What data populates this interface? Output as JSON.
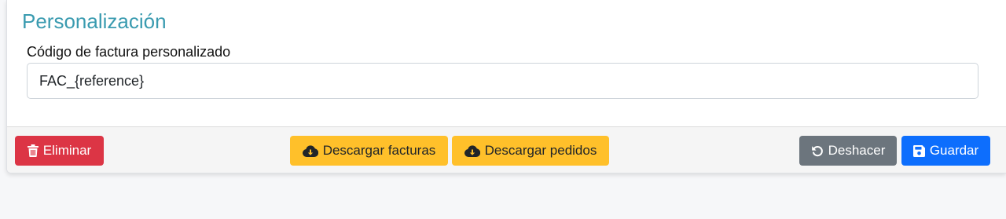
{
  "section": {
    "title": "Personalización"
  },
  "field": {
    "label": "Código de factura personalizado",
    "value": "FAC_{reference}"
  },
  "footer": {
    "delete_label": "Eliminar",
    "download_invoices_label": "Descargar facturas",
    "download_orders_label": "Descargar pedidos",
    "undo_label": "Deshacer",
    "save_label": "Guardar"
  },
  "icons": {
    "delete": "trash-icon",
    "download_invoices": "cloud-download-icon",
    "download_orders": "cloud-download-icon",
    "undo": "undo-icon",
    "save": "floppy-disk-icon"
  },
  "colors": {
    "title": "#3a9bb0",
    "danger": "#dc3545",
    "warning": "#ffc02a",
    "secondary": "#6c757d",
    "primary": "#0d6efd"
  }
}
